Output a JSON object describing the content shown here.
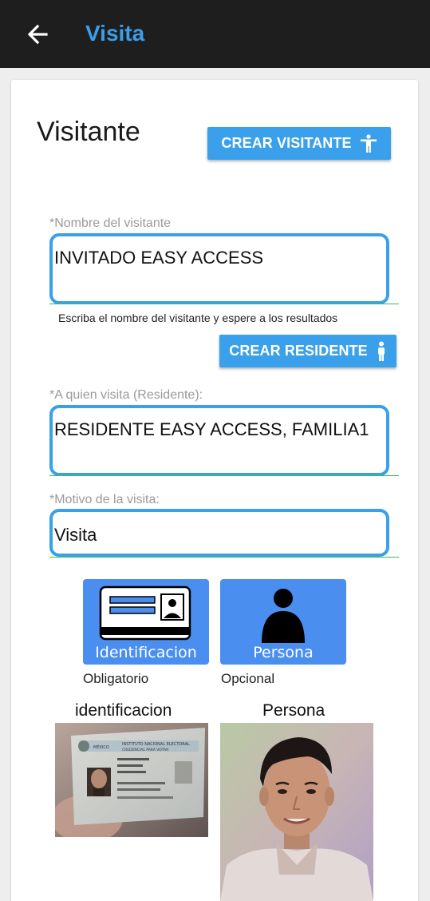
{
  "appbar": {
    "title": "Visita",
    "back_icon": "arrow-left-icon"
  },
  "section": {
    "title": "Visitante"
  },
  "buttons": {
    "crear_visitante": "CREAR VISITANTE",
    "crear_residente": "CREAR RESIDENTE"
  },
  "fields": {
    "visitante": {
      "label": "*Nombre del visitante",
      "value": "INVITADO EASY ACCESS"
    },
    "helper": "Escriba el nombre del visitante y espere a los resultados",
    "residente": {
      "label": "*A quien visita (Residente):",
      "value": "RESIDENTE  EASY ACCESS, FAMILIA1"
    },
    "motivo": {
      "label": "*Motivo de la visita:",
      "value": "Visita"
    }
  },
  "tiles": {
    "identificacion": {
      "label": "Identificacion",
      "note": "Obligatorio"
    },
    "persona": {
      "label": "Persona",
      "note": "Opcional"
    }
  },
  "photos": {
    "identificacion_title": "identificacion",
    "persona_title": "Persona",
    "id_card_text": [
      "MÉXICO",
      "INSTITUTO NACIONAL ELECTORAL",
      "CREDENCIAL PARA VOTAR"
    ]
  },
  "colors": {
    "accent": "#3aa0ec",
    "appbar": "#1e1e1e",
    "tile": "#4a8ff0",
    "underline": "#3bbd5a"
  }
}
